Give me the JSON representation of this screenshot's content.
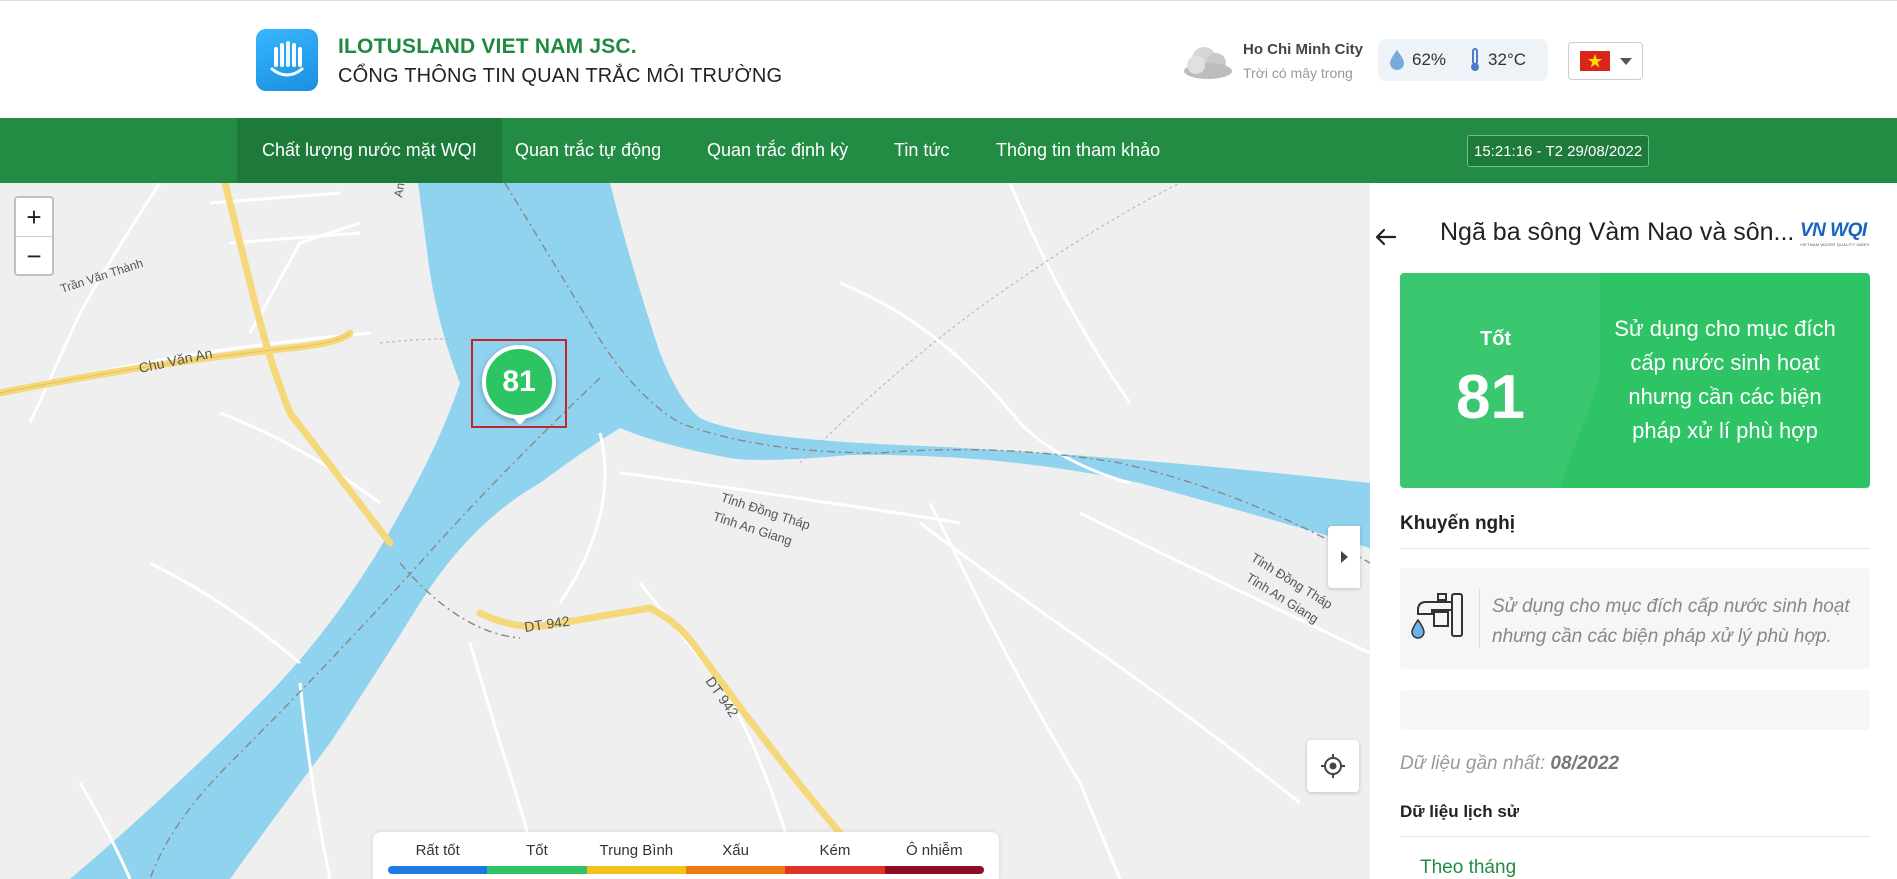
{
  "header": {
    "brand_name": "ILOTUSLAND VIET NAM JSC.",
    "brand_sub": "CỔNG THÔNG TIN QUAN TRẮC MÔI TRƯỜNG",
    "logo_icon": "lotus-logo-icon"
  },
  "weather": {
    "city": "Ho Chi Minh City",
    "description": "Trời có mây trong",
    "humidity": "62%",
    "temperature": "32°C",
    "icon": "cloudy-icon"
  },
  "language": {
    "flag": "vietnam-flag-icon"
  },
  "nav": {
    "items": [
      {
        "label": "Chất lượng nước mặt WQI",
        "active": true
      },
      {
        "label": "Quan trắc tự động"
      },
      {
        "label": "Quan trắc định kỳ"
      },
      {
        "label": "Tin tức"
      },
      {
        "label": "Thông tin tham khảo"
      }
    ],
    "clock": "15:21:16 - T2 29/08/2022"
  },
  "map": {
    "zoom_in": "+",
    "zoom_out": "−",
    "marker_value": "81",
    "labels": {
      "road_chu_van_an": "Chu Văn An",
      "road_tran_van_thanh": "Trần Văn Thành",
      "road_dt942_a": "DT 942",
      "road_dt942_b": "DT 942",
      "road_an": "An",
      "boundary_1a": "Tỉnh Đồng Tháp",
      "boundary_1b": "Tỉnh An Giang",
      "boundary_2a": "Tỉnh Đồng Tháp",
      "boundary_2b": "Tỉnh An Giang"
    }
  },
  "legend": {
    "labels": [
      "Rất tốt",
      "Tốt",
      "Trung Bình",
      "Xấu",
      "Kém",
      "Ô nhiễm"
    ],
    "colors": [
      "#1e7ae0",
      "#2ec466",
      "#f2c21b",
      "#ef7a16",
      "#e0342a",
      "#8b0e26"
    ]
  },
  "panel": {
    "station_title": "Ngã ba sông Vàm Nao và sôn...",
    "badge_title": "VN WQI",
    "badge_sub": "VIETNAM WATER QUALITY INDEX",
    "wqi_level": "Tốt",
    "wqi_value": "81",
    "wqi_desc": "Sử dụng cho mục đích cấp nước sinh hoạt nhưng cần các biện pháp xử lí phù hợp",
    "wqi_color": "#2ec466",
    "recommend_title": "Khuyến nghị",
    "recommend_text": "Sử dụng cho mục đích cấp nước sinh hoạt nhưng cần các biện pháp xử lý phù hợp.",
    "latest_label": "Dữ liệu gần nhất:",
    "latest_value": "08/2022",
    "history_title": "Dữ liệu lịch sử",
    "history_tab": "Theo tháng"
  }
}
